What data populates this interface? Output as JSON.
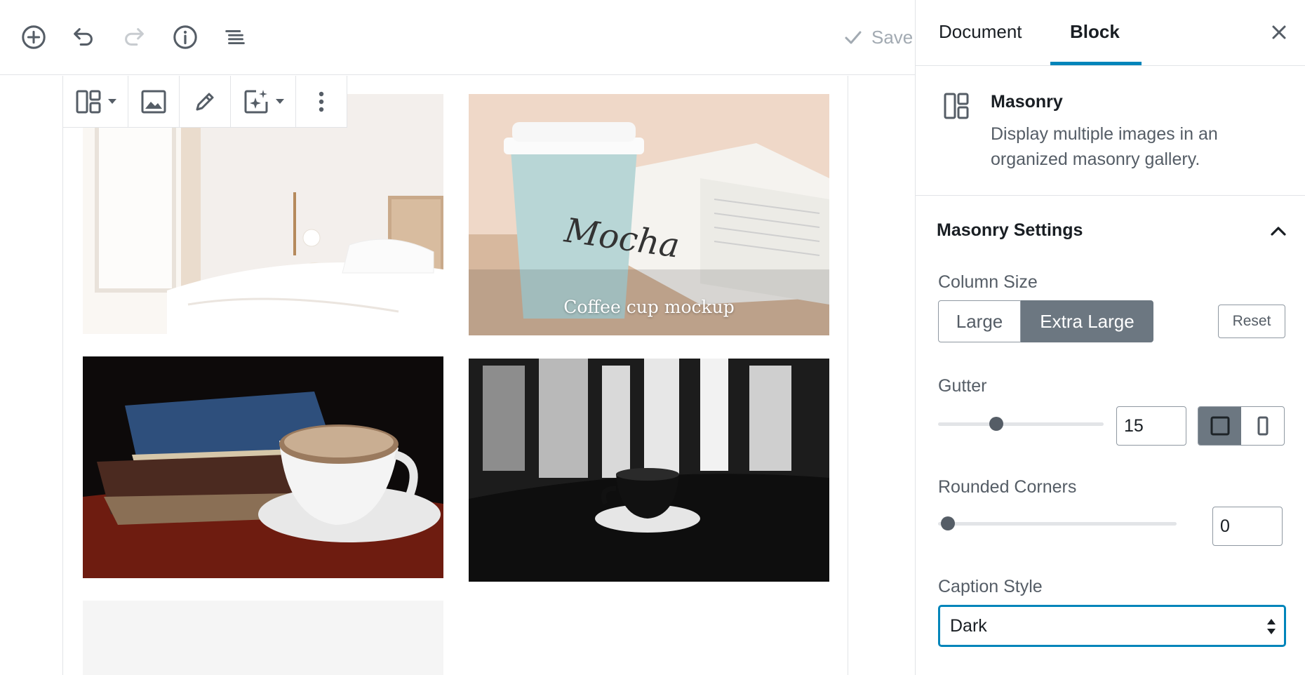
{
  "toolbar": {
    "save_label": "Save"
  },
  "gallery": {
    "items": [
      {
        "caption": ""
      },
      {
        "caption": "Coffee cup mockup"
      },
      {
        "caption": ""
      },
      {
        "caption": ""
      }
    ]
  },
  "sidebar": {
    "tabs": [
      {
        "label": "Document",
        "active": false
      },
      {
        "label": "Block",
        "active": true
      }
    ],
    "block": {
      "title": "Masonry",
      "description": "Display multiple images in an organized masonry gallery."
    },
    "panel": {
      "title": "Masonry Settings",
      "column_size": {
        "label": "Column Size",
        "options": [
          "Large",
          "Extra Large"
        ],
        "selected": "Extra Large",
        "reset_label": "Reset"
      },
      "gutter": {
        "label": "Gutter",
        "value": "15",
        "slider_fraction": 0.33
      },
      "rounded_corners": {
        "label": "Rounded Corners",
        "value": "0",
        "slider_fraction": 0
      },
      "caption_style": {
        "label": "Caption Style",
        "value": "Dark"
      }
    }
  },
  "colors": {
    "accent": "#0085ba",
    "segment_active": "#6c7781",
    "text": "#191e23",
    "muted": "#555d66"
  }
}
